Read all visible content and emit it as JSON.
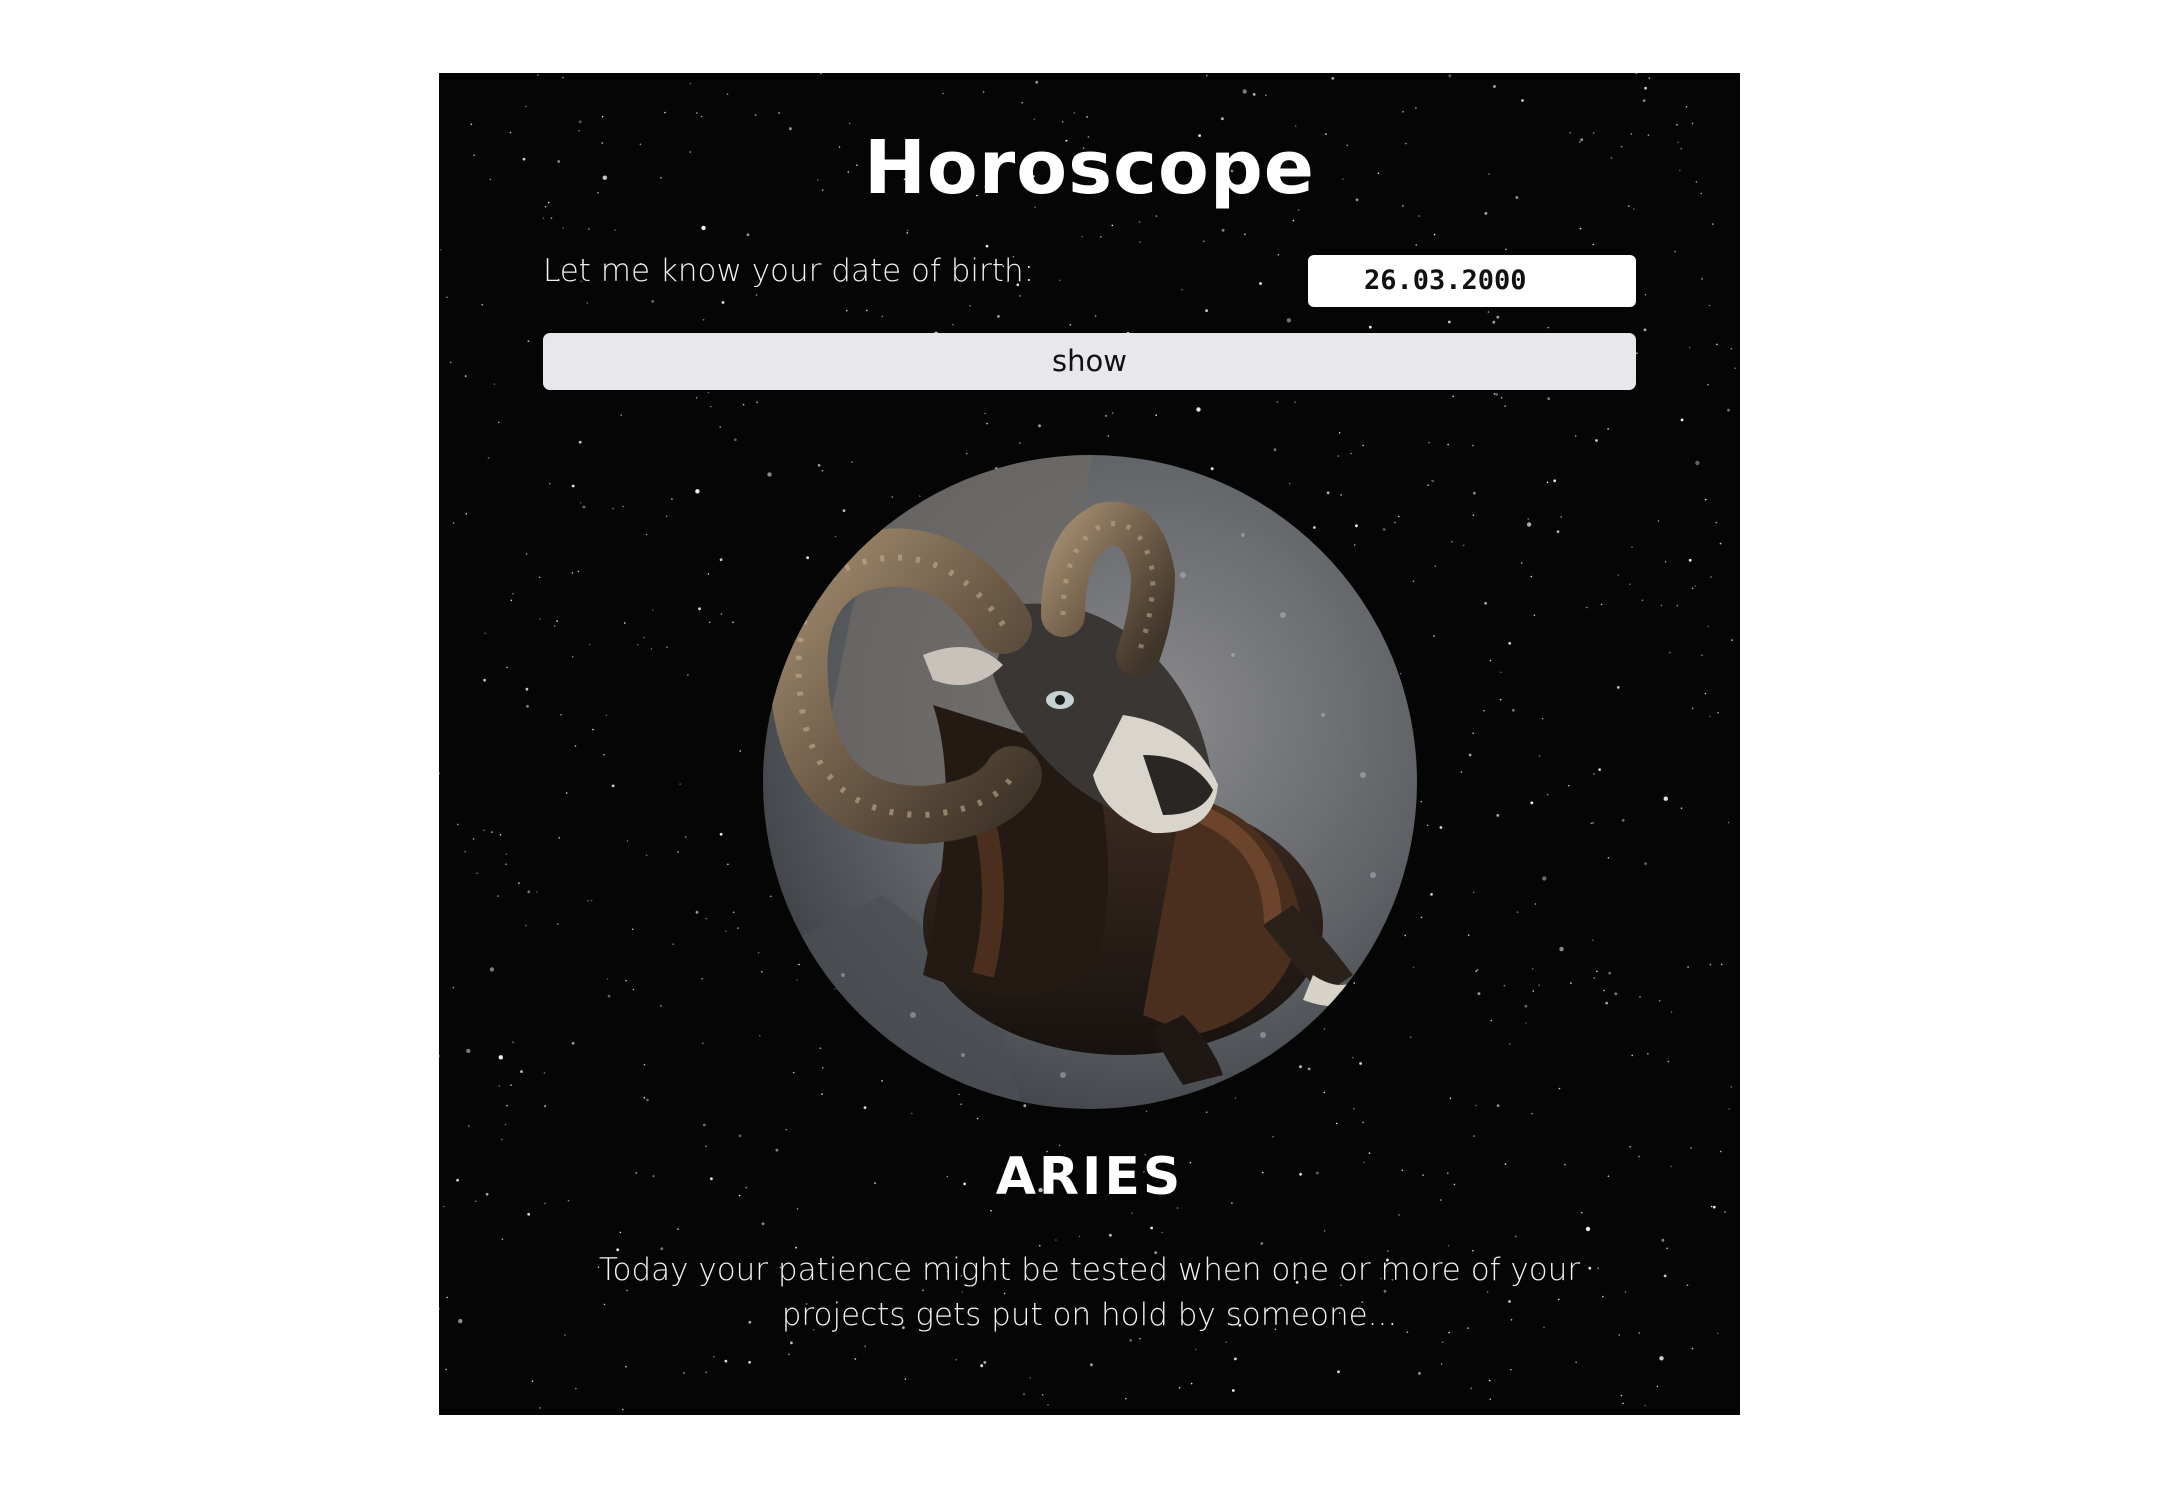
{
  "header": {
    "title": "Horoscope"
  },
  "form": {
    "dob_label": "Let me know your date of birth:",
    "dob_value": "26.03.2000",
    "show_label": "show"
  },
  "result": {
    "image_icon": "ram-photo",
    "sign": "ARIES",
    "description": "Today your patience might be tested when one or more of your projects gets put on hold by someone..."
  },
  "colors": {
    "panel_background": "#050505",
    "text": "#ffffff",
    "button_background": "#e8e8ec"
  }
}
